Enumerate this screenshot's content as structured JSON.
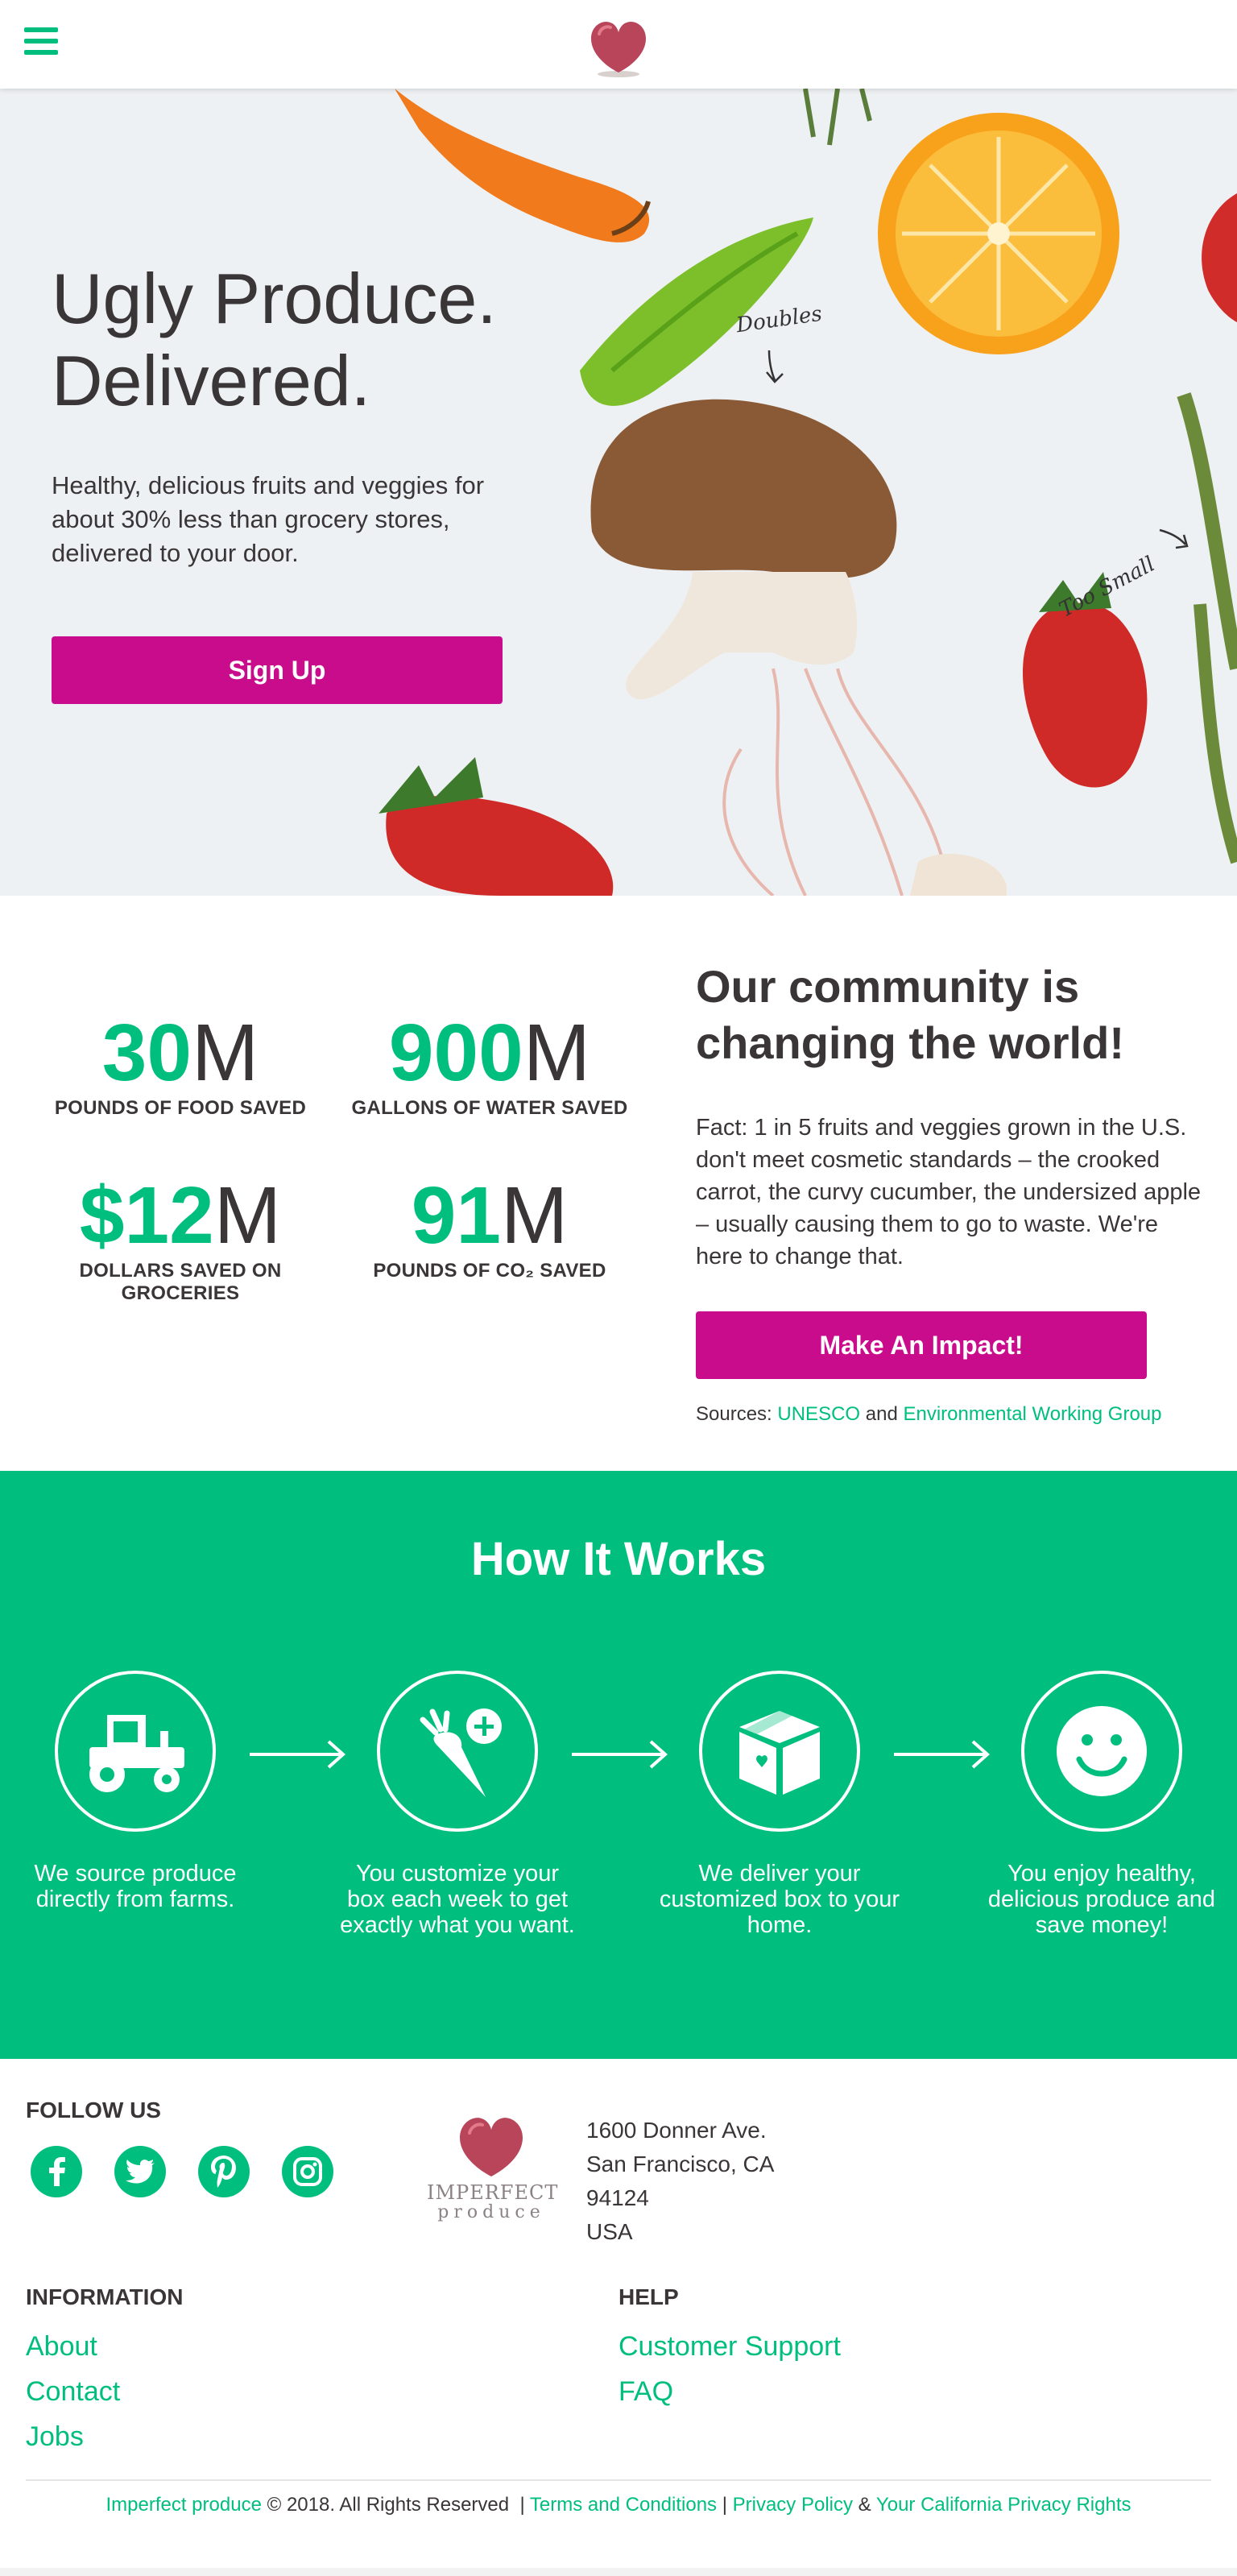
{
  "hero": {
    "title_line1": "Ugly Produce.",
    "title_line2": "Delivered.",
    "text": "Healthy, delicious fruits and veggies for about 30% less than grocery stores, delivered to your door.",
    "signup_label": "Sign Up",
    "doodle_doubles": "Doubles",
    "doodle_small": "Too Small"
  },
  "stats": {
    "items": [
      {
        "prefix": "30",
        "suffix": "M",
        "label": "POUNDS OF FOOD SAVED"
      },
      {
        "prefix": "900",
        "suffix": "M",
        "label": "GALLONS OF WATER SAVED"
      },
      {
        "prefix": "$12",
        "suffix": "M",
        "label": "DOLLARS SAVED ON GROCERIES"
      },
      {
        "prefix": "91",
        "suffix": "M",
        "label": "POUNDS OF CO₂ SAVED"
      }
    ]
  },
  "community": {
    "title": "Our community is changing the world!",
    "text": "Fact: 1 in 5 fruits and veggies grown in the U.S. don't meet cosmetic standards – the crooked carrot, the curvy cucumber, the undersized apple – usually causing them to go to waste. We're here to change that.",
    "button_label": "Make An Impact!",
    "sources_prefix": "Sources:",
    "source1": "UNESCO",
    "sources_and": "and",
    "source2": "Environmental Working Group"
  },
  "how": {
    "title": "How It Works",
    "steps": [
      {
        "icon": "tractor-icon",
        "text": "We source produce directly from farms."
      },
      {
        "icon": "carrot-plus-icon",
        "text": "You customize your box each week to get exactly what you want."
      },
      {
        "icon": "box-heart-icon",
        "text": "We deliver your customized box to your home."
      },
      {
        "icon": "smiley-icon",
        "text": "You enjoy healthy, delicious produce and save money!"
      }
    ]
  },
  "footer": {
    "follow_heading": "FOLLOW US",
    "social": [
      "facebook-icon",
      "twitter-icon",
      "pinterest-icon",
      "instagram-icon"
    ],
    "logo_word1": "IMPERFECT",
    "logo_word2": "produce",
    "address": [
      "1600 Donner Ave.",
      "San Francisco, CA",
      "94124",
      "USA"
    ],
    "info_heading": "INFORMATION",
    "info_links": [
      "About",
      "Contact",
      "Jobs"
    ],
    "help_heading": "HELP",
    "help_links": [
      "Customer Support",
      "FAQ"
    ],
    "copy_brand": "Imperfect produce",
    "copy_text": "© 2018. All Rights Reserved",
    "copy_sep": "|",
    "terms": "Terms and Conditions",
    "privacy": "Privacy Policy",
    "amp": "&",
    "ca_privacy": "Your California Privacy Rights"
  },
  "colors": {
    "accent_green": "#00bf7e",
    "button_magenta": "#c90c8c",
    "text_dark": "#3a3536"
  }
}
